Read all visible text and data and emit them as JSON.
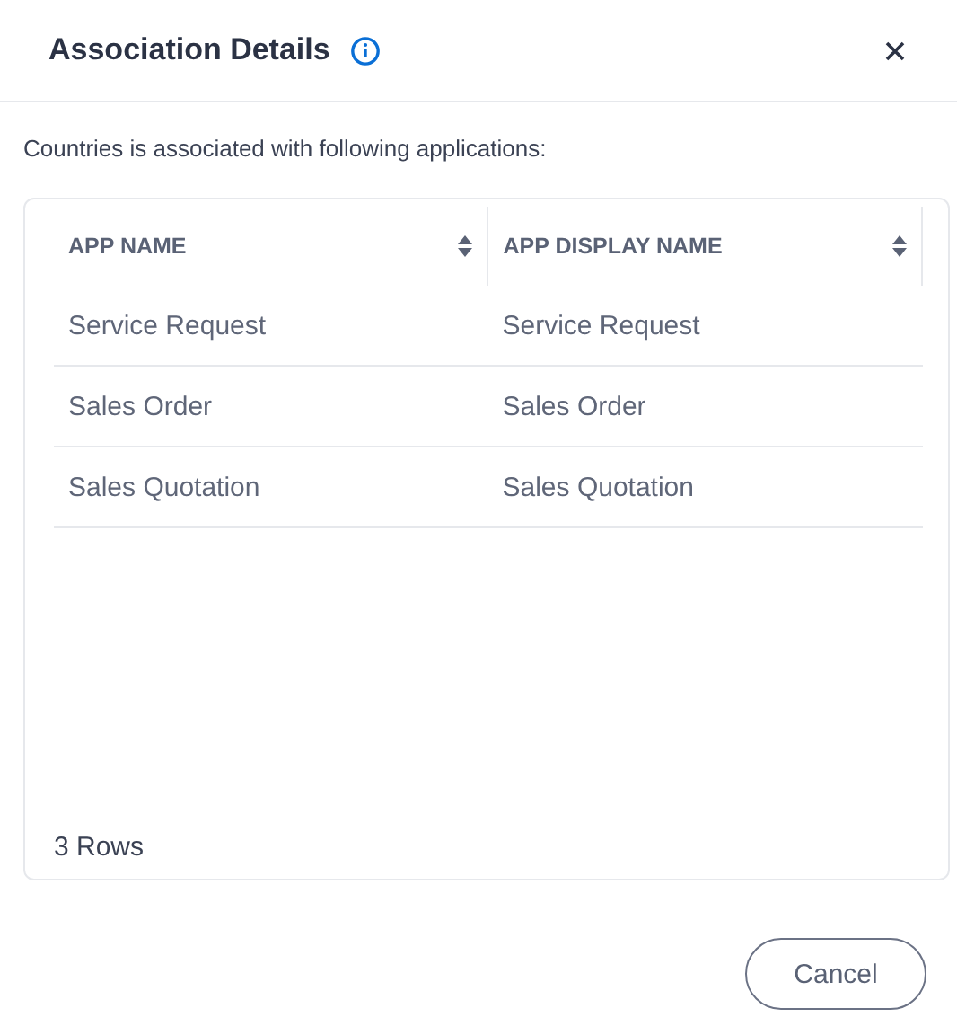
{
  "dialog": {
    "title": "Association Details"
  },
  "description": "Countries is associated with following applications:",
  "table": {
    "columns": [
      {
        "label": "APP NAME"
      },
      {
        "label": "APP DISPLAY NAME"
      }
    ],
    "rows": [
      [
        "Service Request",
        "Service Request"
      ],
      [
        "Sales Order",
        "Sales Order"
      ],
      [
        "Sales Quotation",
        "Sales Quotation"
      ]
    ],
    "row_count": "3 Rows"
  },
  "buttons": [
    {
      "label": "Cancel"
    }
  ]
}
